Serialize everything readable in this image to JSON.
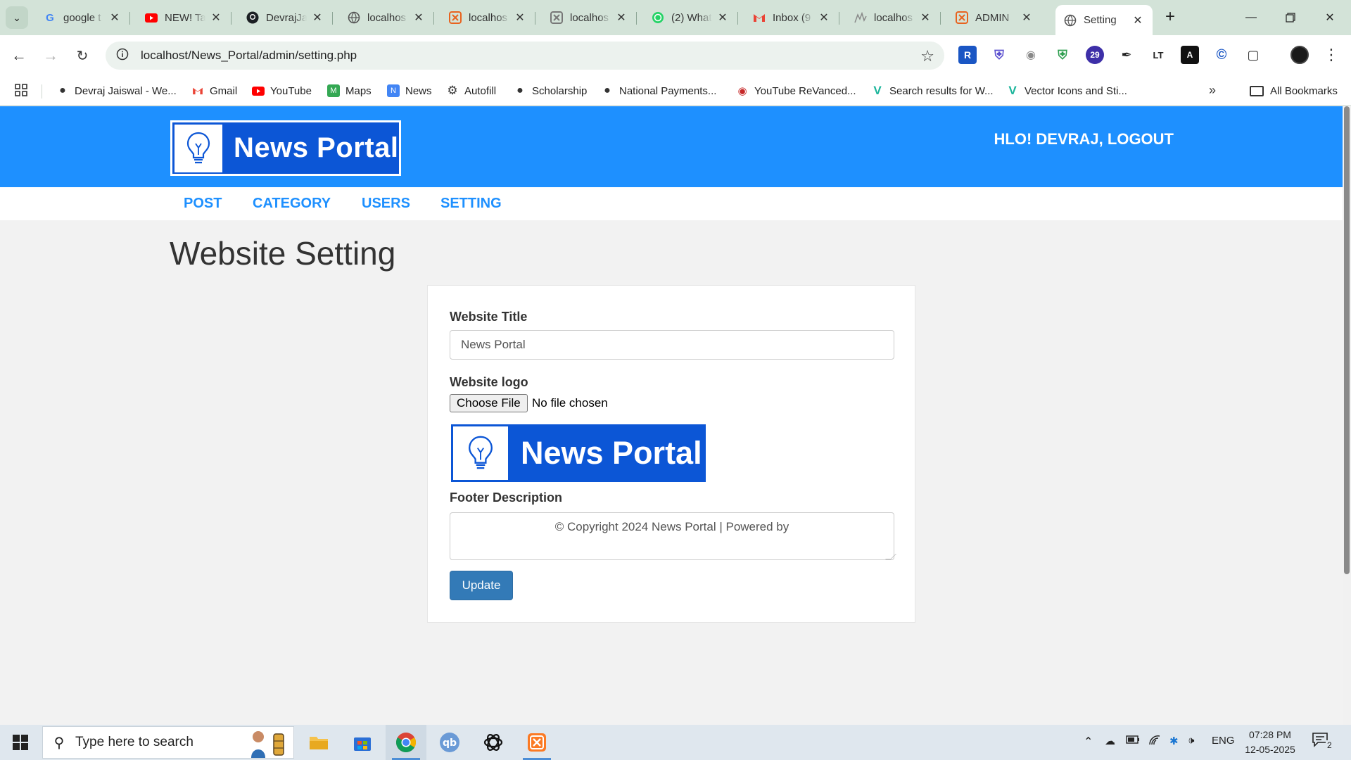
{
  "browser": {
    "tabs": [
      {
        "label": "google t",
        "icon": "google-icon"
      },
      {
        "label": "NEW! Ta",
        "icon": "youtube-icon"
      },
      {
        "label": "DevrajJa",
        "icon": "github-icon"
      },
      {
        "label": "localhos",
        "icon": "globe-icon"
      },
      {
        "label": "localhos",
        "icon": "xampp-icon"
      },
      {
        "label": "localhos",
        "icon": "xampp-gray-icon"
      },
      {
        "label": "(2) What",
        "icon": "whatsapp-icon"
      },
      {
        "label": "Inbox (9",
        "icon": "gmail-icon"
      },
      {
        "label": "localhos",
        "icon": "graph-icon"
      },
      {
        "label": "ADMIN",
        "icon": "xampp-icon"
      },
      {
        "label": "Setting",
        "icon": "globe-icon",
        "active": true
      }
    ],
    "url": "localhost/News_Portal/admin/setting.php",
    "extension_badge": "29",
    "bookmarks": [
      {
        "label": "Devraj Jaiswal - We...",
        "icon": "globe-icon"
      },
      {
        "label": "Gmail",
        "icon": "gmail-icon"
      },
      {
        "label": "YouTube",
        "icon": "youtube-icon"
      },
      {
        "label": "Maps",
        "icon": "maps-icon"
      },
      {
        "label": "News",
        "icon": "news-icon"
      },
      {
        "label": "Autofill",
        "icon": "gear-icon"
      },
      {
        "label": "Scholarship",
        "icon": "globe-icon"
      },
      {
        "label": "National Payments...",
        "icon": "globe-icon"
      },
      {
        "label": "YouTube ReVanced...",
        "icon": "revanced-icon"
      },
      {
        "label": "Search results for W...",
        "icon": "vector-icon"
      },
      {
        "label": "Vector Icons and Sti...",
        "icon": "vector-icon"
      }
    ],
    "all_bookmarks": "All Bookmarks"
  },
  "site": {
    "logo_text": "News Portal",
    "greeting": "HLO! DEVRAJ, LOGOUT",
    "menu": [
      "POST",
      "CATEGORY",
      "USERS",
      "SETTING"
    ],
    "heading": "Website Setting"
  },
  "form": {
    "title_label": "Website Title",
    "title_value": "News Portal",
    "logo_label": "Website logo",
    "file_button": "Choose File",
    "file_status": "No file chosen",
    "logo_preview_text": "News Portal",
    "footer_label": "Footer Description",
    "footer_value": "© Copyright 2024 News Portal | Powered by",
    "submit": "Update"
  },
  "taskbar": {
    "search_placeholder": "Type here to search",
    "language": "ENG",
    "time": "07:28 PM",
    "date": "12-05-2025",
    "notification_count": "2"
  },
  "colors": {
    "header_blue": "#1e90ff",
    "logo_blue": "#0c56d6",
    "button_blue": "#337ab7"
  }
}
